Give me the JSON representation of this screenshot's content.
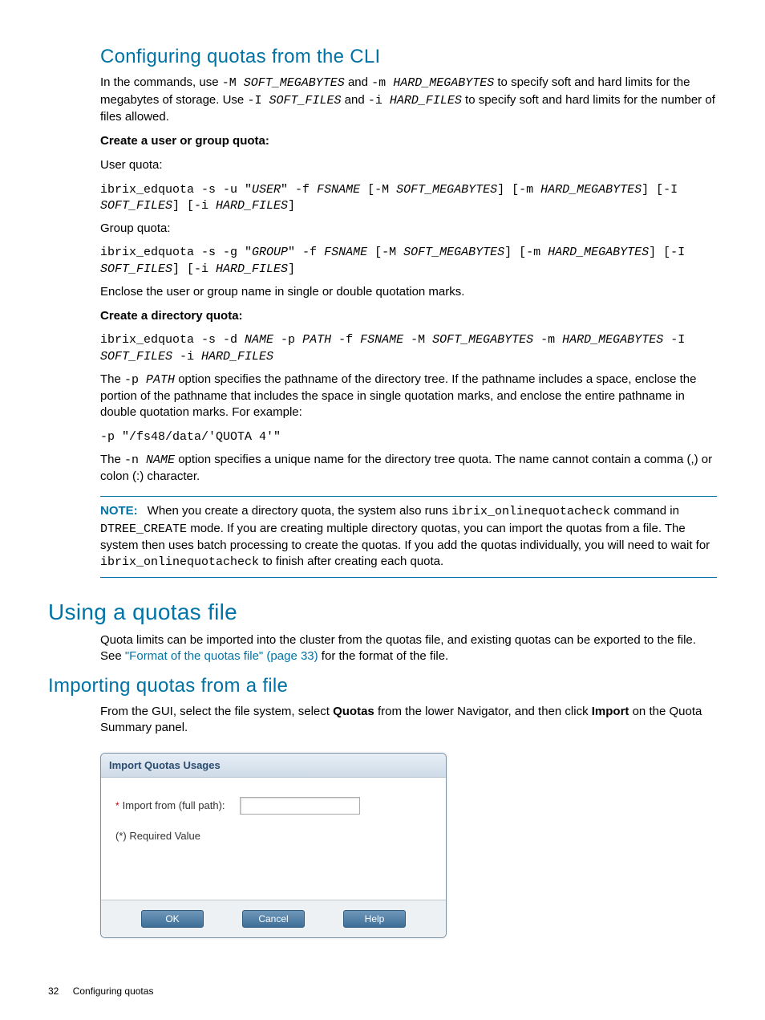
{
  "section1": {
    "heading": "Configuring quotas from the CLI",
    "intro_pre": "In the commands, use ",
    "c1": "-M ",
    "c1i": "SOFT_MEGABYTES",
    "mid1": " and ",
    "c2": "-m ",
    "c2i": "HARD_MEGABYTES",
    "mid2": " to specify soft and hard limits for the megabytes of storage. Use ",
    "c3": "-I ",
    "c3i": "SOFT_FILES",
    "mid3": " and ",
    "c4": "-i ",
    "c4i": "HARD_FILES",
    "tail": " to specify soft and hard limits for the number of files allowed.",
    "sub1": "Create a user or group quota:",
    "user_label": "User quota:",
    "user_cmd_p1": "ibrix_edquota -s -u \"",
    "user_cmd_user": "USER",
    "user_cmd_p2": "\" -f ",
    "user_cmd_fs": "FSNAME",
    "user_cmd_p3": " [-M ",
    "user_cmd_sm": "SOFT_MEGABYTES",
    "user_cmd_p4": "] [-m ",
    "user_cmd_hm": "HARD_MEGABYTES",
    "user_cmd_p5": "] [-I ",
    "user_cmd_sf": "SOFT_FILES",
    "user_cmd_p6": "] [-i ",
    "user_cmd_hf": "HARD_FILES",
    "user_cmd_p7": "]",
    "group_label": "Group quota:",
    "grp_cmd_p1": "ibrix_edquota -s -g \"",
    "grp_cmd_g": "GROUP",
    "grp_cmd_p2": "\" -f ",
    "quote_note": "Enclose the user or group name in single or double quotation marks.",
    "sub2": "Create a directory quota:",
    "dir_cmd_p1": "ibrix_edquota -s -d ",
    "dir_cmd_name": "NAME",
    "dir_cmd_p2": " -p ",
    "dir_cmd_path": "PATH",
    "dir_cmd_p3": " -f ",
    "dir_cmd_fs": "FSNAME",
    "dir_cmd_p4": " -M ",
    "dir_cmd_sm": "SOFT_MEGABYTES",
    "dir_cmd_p5": " -m ",
    "dir_cmd_hm": "HARD_MEGABYTES",
    "dir_cmd_p6": " -I ",
    "dir_cmd_sf": "SOFT_FILES",
    "dir_cmd_p7": " -i ",
    "dir_cmd_hf": "HARD_FILES",
    "p_para_pre": "The ",
    "p_para_flag": "-p ",
    "p_para_path": "PATH",
    "p_para_rest": " option specifies the pathname of the directory tree. If the pathname includes a space, enclose the portion of the pathname that includes the space in single quotation marks, and enclose the entire pathname in double quotation marks. For example:",
    "p_example": "-p \"/fs48/data/'QUOTA 4'\"",
    "n_para_pre": "The ",
    "n_para_flag": "-n ",
    "n_para_name": "NAME",
    "n_para_rest": " option specifies a unique name for the directory tree quota. The name cannot contain a comma (,) or colon (:) character.",
    "note_label": "NOTE:",
    "note_p1": "When you create a directory quota, the system also runs ",
    "note_c1": "ibrix_onlinequotacheck",
    "note_p2": " command in ",
    "note_c2": "DTREE_CREATE",
    "note_p3": " mode. If you are creating multiple directory quotas, you can import the quotas from a file. The system then uses batch processing to create the quotas. If you add the quotas individually, you will need to wait for ",
    "note_c3": "ibrix_onlinequotacheck",
    "note_p4": " to finish after creating each quota."
  },
  "section2": {
    "heading": "Using a quotas file",
    "para_pre": "Quota limits can be imported into the cluster from the quotas file, and existing quotas can be exported to the file. See ",
    "link": "\"Format of the quotas file\" (page 33)",
    "para_post": " for the format of the file."
  },
  "section3": {
    "heading": "Importing quotas from a file",
    "para_p1": "From the GUI, select the file system, select ",
    "para_b1": "Quotas",
    "para_p2": " from the lower Navigator, and then click ",
    "para_b2": "Import",
    "para_p3": " on the Quota Summary panel."
  },
  "dialog": {
    "title": "Import Quotas Usages",
    "label": "Import from (full path):",
    "required": "(*) Required Value",
    "input_value": "",
    "ok": "OK",
    "cancel": "Cancel",
    "help": "Help"
  },
  "footer": {
    "page": "32",
    "title": "Configuring quotas"
  }
}
